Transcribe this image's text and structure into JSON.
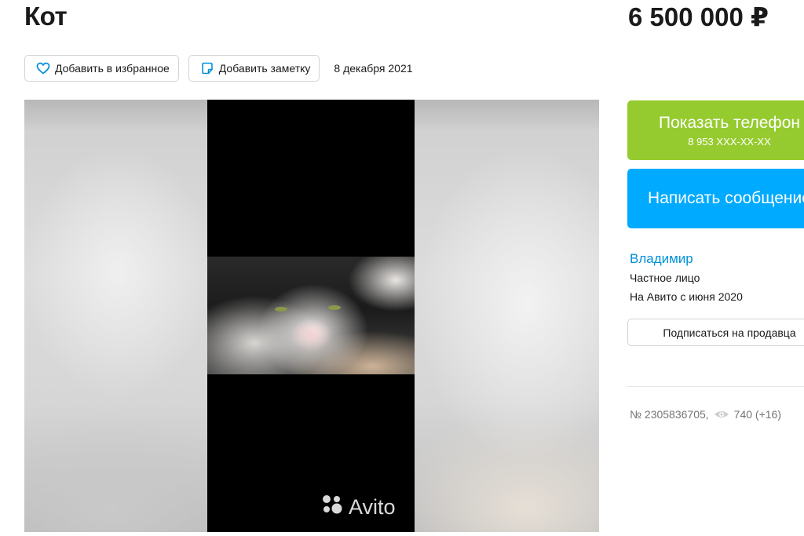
{
  "listing": {
    "title": "Кот",
    "price": "6 500 000 ₽",
    "date": "8 декабря 2021"
  },
  "actions": {
    "favorite_label": "Добавить в избранное",
    "note_label": "Добавить заметку",
    "favorite_icon": "heart-icon",
    "note_icon": "note-icon"
  },
  "gallery": {
    "watermark": "Avito"
  },
  "contact": {
    "show_phone_label": "Показать телефон",
    "phone_masked": "8 953 XXX-XX-XX",
    "message_label": "Написать сообщение"
  },
  "seller": {
    "name": "Владимир",
    "type": "Частное лицо",
    "since": "На Авито с июня 2020",
    "subscribe_label": "Подписаться на продавца"
  },
  "meta": {
    "ad_number": "№ 2305836705,",
    "views": "740 (+16)"
  },
  "colors": {
    "green": "#96cb30",
    "blue": "#00aaff",
    "link": "#0091d9"
  }
}
